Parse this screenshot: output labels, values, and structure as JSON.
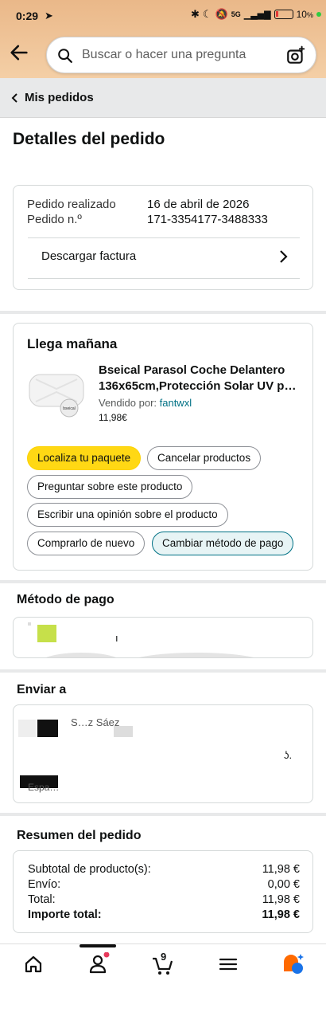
{
  "status_bar": {
    "time": "0:29",
    "battery": "10",
    "network": "5G"
  },
  "search": {
    "placeholder": "Buscar o hacer una pregunta"
  },
  "breadcrumb": {
    "label": "Mis pedidos"
  },
  "page": {
    "title": "Detalles del pedido"
  },
  "order_info": {
    "placed_label": "Pedido realizado",
    "placed_value": "16 de abril de 2026",
    "number_label": "Pedido n.º",
    "number_value": "171-3354177-3488333",
    "invoice_label": "Descargar factura"
  },
  "shipment": {
    "title": "Llega mañana",
    "product_name": "Bseical Parasol Coche Delantero 136x65cm,Protección Solar UV p…",
    "sold_by_label": "Vendido por: ",
    "seller": "fantwxl",
    "price": "11,98€",
    "image_brand": "bseical",
    "buttons": {
      "track": "Localiza tu paquete",
      "cancel": "Cancelar productos",
      "ask": "Preguntar sobre este producto",
      "review": "Escribir una opinión sobre el producto",
      "buy_again": "Comprarlo de nuevo",
      "change_payment": "Cambiar método de pago"
    }
  },
  "payment": {
    "title": "Método de pago",
    "card_suffix": "ı"
  },
  "shipping": {
    "title": "Enviar a",
    "name_partial": "S…z Sáez",
    "city_partial": "ʖ.",
    "country_partial": "Espa…"
  },
  "summary": {
    "title": "Resumen del pedido",
    "rows": [
      {
        "label": "Subtotal de producto(s):",
        "value": "11,98 €"
      },
      {
        "label": "Envío:",
        "value": "0,00 €"
      },
      {
        "label": "Total:",
        "value": "11,98 €"
      },
      {
        "label": "Importe total:",
        "value": "11,98 €"
      }
    ]
  },
  "nav": {
    "cart_count": "9"
  },
  "colors": {
    "header": "#eab889",
    "primary_button": "#FFD814",
    "link": "#007185",
    "accent": "#ff6a00"
  }
}
